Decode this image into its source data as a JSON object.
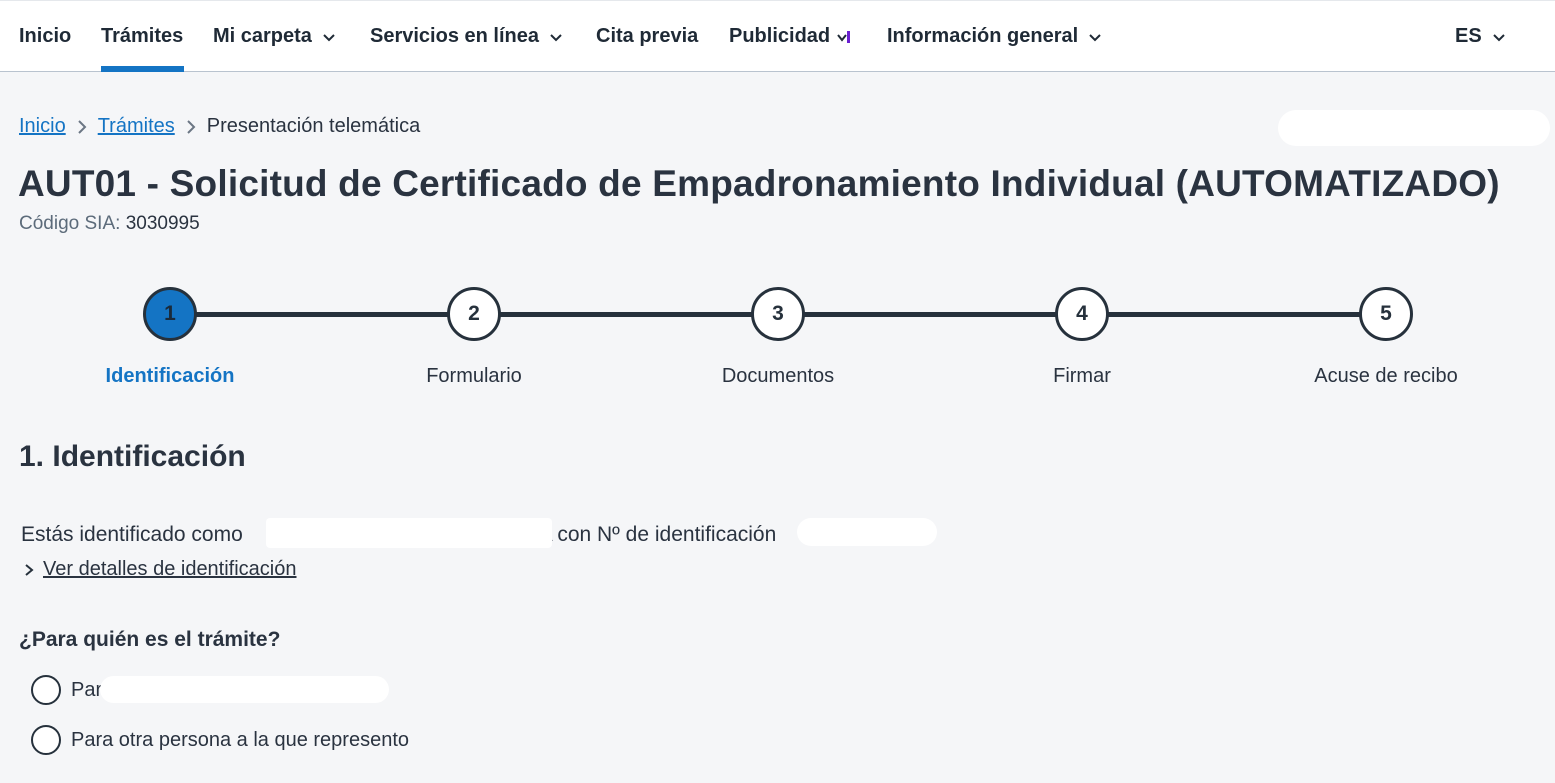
{
  "nav": {
    "items": [
      {
        "label": "Inicio"
      },
      {
        "label": "Trámites"
      },
      {
        "label": "Mi carpeta"
      },
      {
        "label": "Servicios en línea"
      },
      {
        "label": "Cita previa"
      },
      {
        "label": "Publicidad"
      },
      {
        "label": "Información general"
      }
    ],
    "language": "ES"
  },
  "breadcrumb": {
    "home": "Inicio",
    "tramites": "Trámites",
    "current": "Presentación telemática"
  },
  "header": {
    "title": "AUT01 - Solicitud de Certificado de Empadronamiento Individual (AUTOMATIZADO)",
    "sia_label": "Código SIA:",
    "sia_value": "3030995"
  },
  "steps": [
    {
      "number": "1",
      "label": "Identificación",
      "active": true
    },
    {
      "number": "2",
      "label": "Formulario",
      "active": false
    },
    {
      "number": "3",
      "label": "Documentos",
      "active": false
    },
    {
      "number": "4",
      "label": "Firmar",
      "active": false
    },
    {
      "number": "5",
      "label": "Acuse de recibo",
      "active": false
    }
  ],
  "section": {
    "title": "1. Identificación",
    "ident_prefix": "Estás identificado como",
    "ident_suffix": "A con Nº de identificación",
    "details_link": "Ver detalles de identificación",
    "question": "¿Para quién es el trámite?",
    "options": [
      {
        "label": "Par"
      },
      {
        "label": "Para otra persona a la que represento"
      }
    ]
  },
  "colors": {
    "accent": "#1474c4",
    "text": "#2a3340",
    "background": "#f5f6f8",
    "publicidad_mark": "#6a1fd1"
  }
}
